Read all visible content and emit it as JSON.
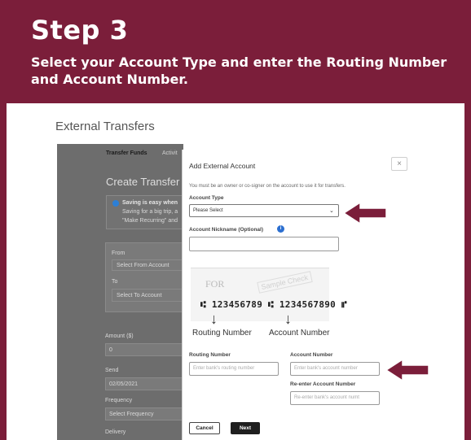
{
  "banner": {
    "step": "Step 3",
    "subtitle": "Select your Account Type and enter the Routing Number and Account Number."
  },
  "page": {
    "title": "External Transfers"
  },
  "background": {
    "tabs": [
      "Transfer Funds",
      "Activit"
    ],
    "create_transfer": "Create Transfer",
    "info_title": "Saving is easy when",
    "info_line1": "Saving for a big trip, a",
    "info_line2": "\"Make Recurring\" and",
    "from_label": "From",
    "from_value": "Select From Account",
    "to_label": "To",
    "to_value": "Select To Account",
    "amount_label": "Amount ($)",
    "amount_value": "0",
    "send_label": "Send",
    "send_value": "02/05/2021",
    "frequency_label": "Frequency",
    "frequency_value": "Select Frequency",
    "delivery_label": "Delivery"
  },
  "modal": {
    "title": "Add External Account",
    "close": "×",
    "note": "You must be an owner or co-signer on the account to use it for transfers.",
    "account_type_label": "Account Type",
    "account_type_value": "Please Select",
    "nickname_label": "Account Nickname (Optional)",
    "nickname_info": "i",
    "check": {
      "for": "FOR",
      "stamp": "Sample Check",
      "numbers": "⑆ 123456789 ⑆ 1234567890 ⑈"
    },
    "routing_caption": "Routing Number",
    "account_caption": "Account Number",
    "routing_label": "Routing Number",
    "routing_placeholder": "Enter bank's routing number",
    "account_label": "Account Number",
    "account_placeholder": "Enter bank's account number",
    "reenter_label": "Re-enter Account Number",
    "reenter_placeholder": "Re-enter bank's account numt",
    "cancel": "Cancel",
    "next": "Next"
  },
  "colors": {
    "brand": "#7b1e3a",
    "arrow": "#7b1e3a",
    "info": "#2c6fd0"
  }
}
